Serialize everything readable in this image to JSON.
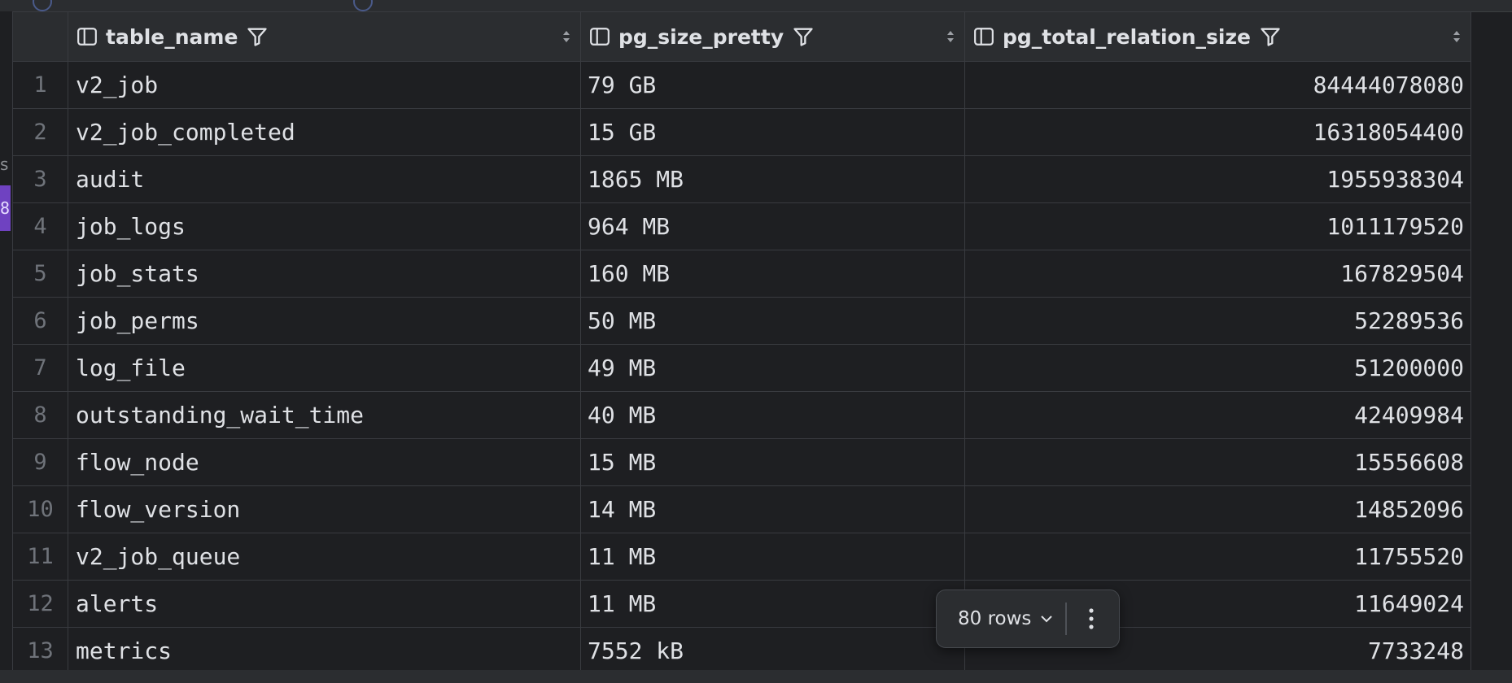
{
  "columns": [
    {
      "label": "table_name"
    },
    {
      "label": "pg_size_pretty"
    },
    {
      "label": "pg_total_relation_size"
    }
  ],
  "rows": [
    {
      "num": "1",
      "table_name": "v2_job",
      "pg_size_pretty": "79 GB",
      "pg_total_relation_size": "84444078080"
    },
    {
      "num": "2",
      "table_name": "v2_job_completed",
      "pg_size_pretty": "15 GB",
      "pg_total_relation_size": "16318054400"
    },
    {
      "num": "3",
      "table_name": "audit",
      "pg_size_pretty": "1865 MB",
      "pg_total_relation_size": "1955938304"
    },
    {
      "num": "4",
      "table_name": "job_logs",
      "pg_size_pretty": "964 MB",
      "pg_total_relation_size": "1011179520"
    },
    {
      "num": "5",
      "table_name": "job_stats",
      "pg_size_pretty": "160 MB",
      "pg_total_relation_size": "167829504"
    },
    {
      "num": "6",
      "table_name": "job_perms",
      "pg_size_pretty": "50 MB",
      "pg_total_relation_size": "52289536"
    },
    {
      "num": "7",
      "table_name": "log_file",
      "pg_size_pretty": "49 MB",
      "pg_total_relation_size": "51200000"
    },
    {
      "num": "8",
      "table_name": "outstanding_wait_time",
      "pg_size_pretty": "40 MB",
      "pg_total_relation_size": "42409984"
    },
    {
      "num": "9",
      "table_name": "flow_node",
      "pg_size_pretty": "15 MB",
      "pg_total_relation_size": "15556608"
    },
    {
      "num": "10",
      "table_name": "flow_version",
      "pg_size_pretty": "14 MB",
      "pg_total_relation_size": "14852096"
    },
    {
      "num": "11",
      "table_name": "v2_job_queue",
      "pg_size_pretty": "11 MB",
      "pg_total_relation_size": "11755520"
    },
    {
      "num": "12",
      "table_name": "alerts",
      "pg_size_pretty": "11 MB",
      "pg_total_relation_size": "11649024"
    },
    {
      "num": "13",
      "table_name": "metrics",
      "pg_size_pretty": "7552 kB",
      "pg_total_relation_size": "7733248"
    }
  ],
  "pagination": {
    "rows_label": "80 rows"
  },
  "icons": {
    "column": "column-icon",
    "filter": "filter-icon",
    "sort": "sort-icon",
    "chevron": "chevron-down-icon",
    "more": "more-vertical-icon"
  },
  "colors": {
    "background": "#1e1f22",
    "header": "#2b2d30",
    "accent": "#6f42c1"
  }
}
